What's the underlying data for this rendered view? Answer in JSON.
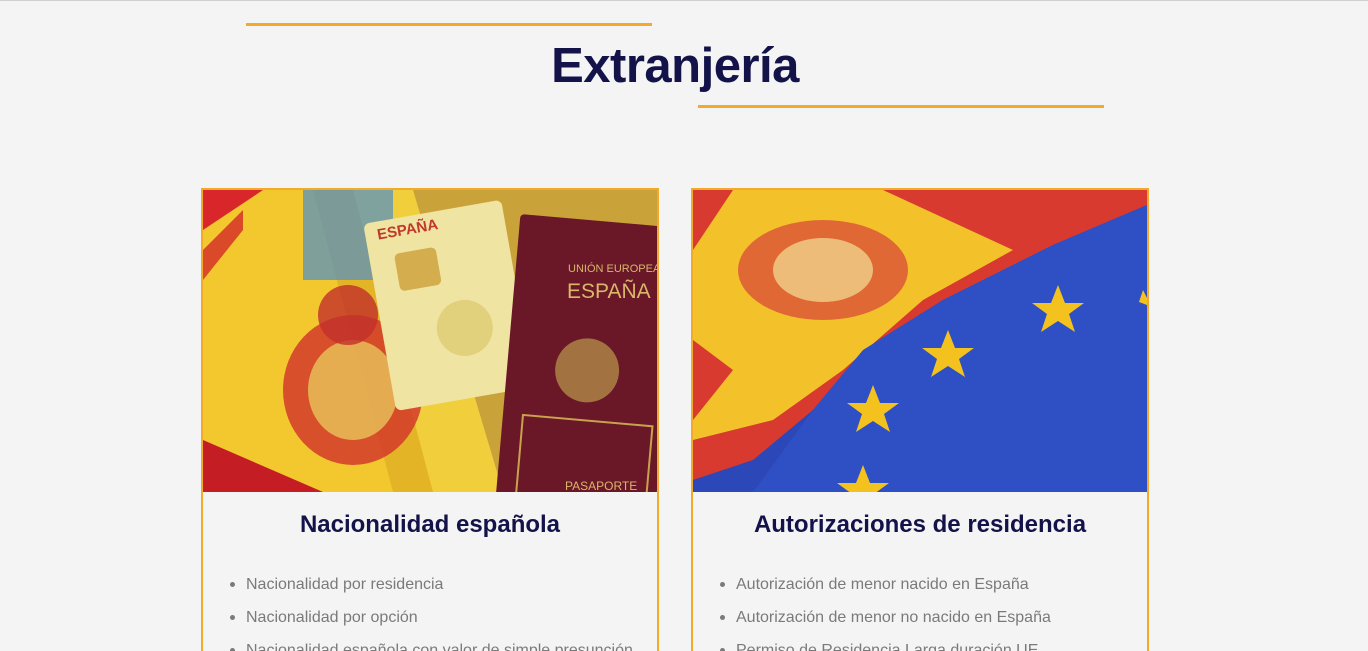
{
  "page": {
    "title": "Extranjería"
  },
  "colors": {
    "accent": "#f3a92a",
    "heading": "#13134a",
    "text": "#7a7a7a",
    "background": "#f4f4f4"
  },
  "cards": [
    {
      "title": "Nacionalidad española",
      "image": "spain-flag-passport-dni-photo",
      "image_text": {
        "dni_country": "ESPAÑA",
        "passport_union": "UNIÓN EUROPEA",
        "passport_country": "ESPAÑA",
        "passport_label": "PASAPORTE"
      },
      "items": [
        "Nacionalidad por residencia",
        "Nacionalidad por opción",
        "Nacionalidad española con valor de simple presunción"
      ]
    },
    {
      "title": "Autorizaciones de residencia",
      "image": "spain-eu-flag-puzzle-photo",
      "items": [
        "Autorización de menor nacido en España",
        "Autorización de menor no nacido en España",
        "Permiso de Residencia Larga duración UE"
      ]
    }
  ]
}
